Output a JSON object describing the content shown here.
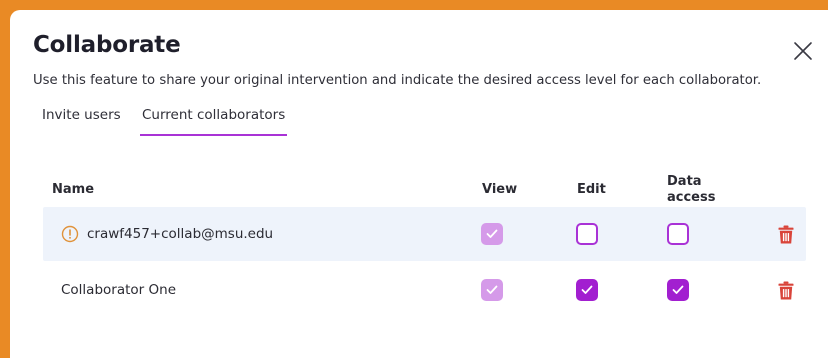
{
  "modal": {
    "title": "Collaborate",
    "subtitle": "Use this feature to share your original intervention and indicate the desired access level for each collaborator.",
    "close_icon": "close-icon"
  },
  "tabs": [
    {
      "label": "Invite users",
      "active": false
    },
    {
      "label": "Current collaborators",
      "active": true
    }
  ],
  "table": {
    "headers": {
      "name": "Name",
      "view": "View",
      "edit": "Edit",
      "data_line1": "Data",
      "data_line2": "access"
    },
    "rows": [
      {
        "name": "crawf457+collab@msu.edu",
        "warning": true,
        "view": true,
        "edit": false,
        "data_access": false
      },
      {
        "name": "Collaborator One",
        "warning": false,
        "view": true,
        "edit": true,
        "data_access": true
      }
    ]
  },
  "colors": {
    "accent": "#a932d6",
    "checked_dark": "#a21fd0",
    "checked_light": "#d59ae9",
    "warning": "#e0923a",
    "delete": "#d9443a",
    "row_highlight": "#eef3fb",
    "frame": "#e98a25"
  }
}
